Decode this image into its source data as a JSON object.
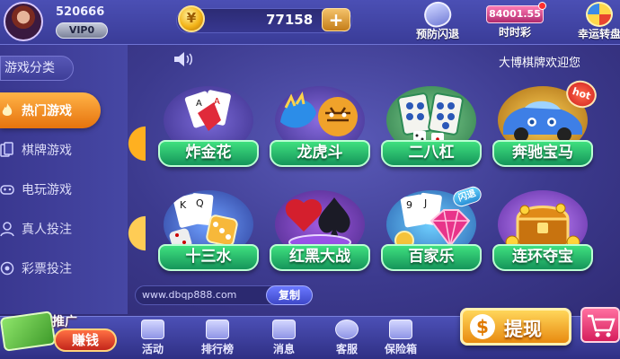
{
  "header": {
    "user_id": "520666",
    "vip": "VIP0",
    "balance": "77158",
    "add": "+",
    "coin_symbol": "¥",
    "buttons": [
      {
        "label": "预防闪退",
        "icon": "shield-icon"
      },
      {
        "label": "时时彩",
        "icon": "lottery-ticket-icon",
        "badge": "84001.55"
      },
      {
        "label": "幸运转盘",
        "icon": "spin-wheel-icon"
      }
    ]
  },
  "announcement": {
    "text": "大博棋牌欢迎您"
  },
  "sidebar": {
    "title": "游戏分类",
    "items": [
      {
        "label": "热门游戏",
        "icon": "flame-icon",
        "active": true
      },
      {
        "label": "棋牌游戏",
        "icon": "cards-icon",
        "active": false
      },
      {
        "label": "电玩游戏",
        "icon": "gamepad-icon",
        "active": false
      },
      {
        "label": "真人投注",
        "icon": "dealer-icon",
        "active": false
      },
      {
        "label": "彩票投注",
        "icon": "ball-icon",
        "active": false
      }
    ]
  },
  "games": [
    {
      "label": "炸金花",
      "art": "poker-cards"
    },
    {
      "label": "龙虎斗",
      "art": "dragon-tiger"
    },
    {
      "label": "二八杠",
      "art": "mahjong-tiles"
    },
    {
      "label": "奔驰宝马",
      "art": "race-car",
      "badge": "hot"
    },
    {
      "label": "十三水",
      "art": "cards-dice"
    },
    {
      "label": "红黑大战",
      "art": "red-black-chips"
    },
    {
      "label": "百家乐",
      "art": "baccarat-gem",
      "badge": "闪退"
    },
    {
      "label": "连环夺宝",
      "art": "treasure-chest"
    }
  ],
  "footer": {
    "url": "www.dbqp888.com",
    "copy": "复制",
    "promo_top": "推广",
    "promo_bottom": "赚钱",
    "nav": [
      {
        "label": "活动",
        "icon": "gift-icon"
      },
      {
        "label": "排行榜",
        "icon": "ranking-icon"
      },
      {
        "label": "消息",
        "icon": "mail-icon"
      },
      {
        "label": "客服",
        "icon": "headset-icon"
      },
      {
        "label": "保险箱",
        "icon": "safe-icon"
      }
    ],
    "withdraw": "提现",
    "withdraw_symbol": "$"
  },
  "colors": {
    "background": "#3c3a8e",
    "accent_orange": "#e6730d",
    "ribbon_green": "#15955a"
  }
}
